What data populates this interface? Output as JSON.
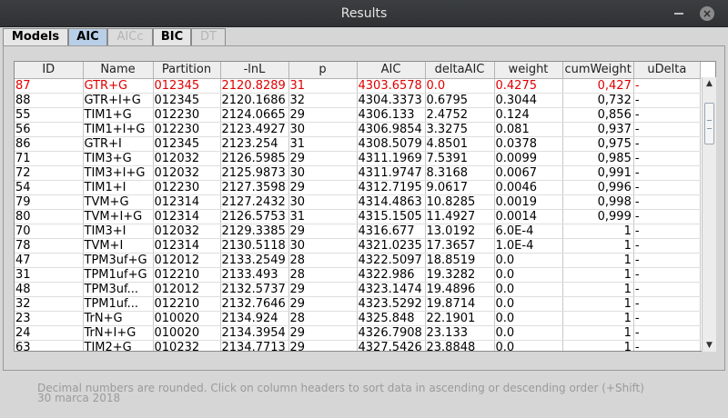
{
  "window": {
    "title": "Results"
  },
  "tabs": [
    {
      "label": "Models",
      "state": "normal"
    },
    {
      "label": "AIC",
      "state": "selected"
    },
    {
      "label": "AICc",
      "state": "disabled"
    },
    {
      "label": "BIC",
      "state": "normal"
    },
    {
      "label": "DT",
      "state": "disabled"
    }
  ],
  "table": {
    "columns": [
      "ID",
      "Name",
      "Partition",
      "-lnL",
      "p",
      "AIC",
      "deltaAIC",
      "weight",
      "cumWeight",
      "uDelta"
    ],
    "rows": [
      [
        "87",
        "GTR+G",
        "012345",
        "2120.8289",
        "31",
        "4303.6578",
        "0.0",
        "0.4275",
        "0,427",
        "-"
      ],
      [
        "88",
        "GTR+I+G",
        "012345",
        "2120.1686",
        "32",
        "4304.3373",
        "0.6795",
        "0.3044",
        "0,732",
        "-"
      ],
      [
        "55",
        "TIM1+G",
        "012230",
        "2124.0665",
        "29",
        "4306.133",
        "2.4752",
        "0.124",
        "0,856",
        "-"
      ],
      [
        "56",
        "TIM1+I+G",
        "012230",
        "2123.4927",
        "30",
        "4306.9854",
        "3.3275",
        "0.081",
        "0,937",
        "-"
      ],
      [
        "86",
        "GTR+I",
        "012345",
        "2123.254",
        "31",
        "4308.5079",
        "4.8501",
        "0.0378",
        "0,975",
        "-"
      ],
      [
        "71",
        "TIM3+G",
        "012032",
        "2126.5985",
        "29",
        "4311.1969",
        "7.5391",
        "0.0099",
        "0,985",
        "-"
      ],
      [
        "72",
        "TIM3+I+G",
        "012032",
        "2125.9873",
        "30",
        "4311.9747",
        "8.3168",
        "0.0067",
        "0,991",
        "-"
      ],
      [
        "54",
        "TIM1+I",
        "012230",
        "2127.3598",
        "29",
        "4312.7195",
        "9.0617",
        "0.0046",
        "0,996",
        "-"
      ],
      [
        "79",
        "TVM+G",
        "012314",
        "2127.2432",
        "30",
        "4314.4863",
        "10.8285",
        "0.0019",
        "0,998",
        "-"
      ],
      [
        "80",
        "TVM+I+G",
        "012314",
        "2126.5753",
        "31",
        "4315.1505",
        "11.4927",
        "0.0014",
        "0,999",
        "-"
      ],
      [
        "70",
        "TIM3+I",
        "012032",
        "2129.3385",
        "29",
        "4316.677",
        "13.0192",
        "6.0E-4",
        "1",
        "-"
      ],
      [
        "78",
        "TVM+I",
        "012314",
        "2130.5118",
        "30",
        "4321.0235",
        "17.3657",
        "1.0E-4",
        "1",
        "-"
      ],
      [
        "47",
        "TPM3uf+G",
        "012012",
        "2133.2549",
        "28",
        "4322.5097",
        "18.8519",
        "0.0",
        "1",
        "-"
      ],
      [
        "31",
        "TPM1uf+G",
        "012210",
        "2133.493",
        "28",
        "4322.986",
        "19.3282",
        "0.0",
        "1",
        "-"
      ],
      [
        "48",
        "TPM3uf...",
        "012012",
        "2132.5737",
        "29",
        "4323.1474",
        "19.4896",
        "0.0",
        "1",
        "-"
      ],
      [
        "32",
        "TPM1uf...",
        "012210",
        "2132.7646",
        "29",
        "4323.5292",
        "19.8714",
        "0.0",
        "1",
        "-"
      ],
      [
        "23",
        "TrN+G",
        "010020",
        "2134.924",
        "28",
        "4325.848",
        "22.1901",
        "0.0",
        "1",
        "-"
      ],
      [
        "24",
        "TrN+I+G",
        "010020",
        "2134.3954",
        "29",
        "4326.7908",
        "23.133",
        "0.0",
        "1",
        "-"
      ],
      [
        "63",
        "TIM2+G",
        "010232",
        "2134.7713",
        "29",
        "4327.5426",
        "23.8848",
        "0.0",
        "1",
        "-"
      ]
    ]
  },
  "footer": {
    "note": "Decimal numbers are rounded. Click on column headers to sort data in ascending or descending order (+Shift)",
    "date": "30 marca 2018"
  },
  "colors": {
    "best_row": "#e00000",
    "tab_selected": "#b9cfe8",
    "titlebar": "#3c3f41"
  },
  "icons": {
    "minimize": "minimize-icon",
    "close": "close-icon"
  }
}
